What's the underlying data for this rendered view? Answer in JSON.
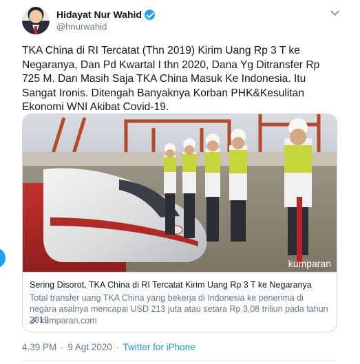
{
  "author": {
    "name": "Hidayat Nur Wahid",
    "handle": "@hnurwahid"
  },
  "tweet": {
    "text": "TKA China di RI Tercatat (Thn 2019) Kirim Uang Rp 3 T ke Negaranya, Dan Pd Kwartal I thn 2020, Dana Yg Ditransfer Rp 725 M. Dan Masih Saja TKA China Masuk Ke Indonesia. Itu Sangat Ironis. Ditengah Banyaknya Korban PHK&Kesulitan Ekonomi WNI Akibat Covid-19."
  },
  "card": {
    "watermark": "kumparan",
    "title": "Sering Disorot, TKA China di RI Tercatat Kirim Uang Rp 3 T ke Negaranya",
    "description": "Total transfer uang TKA China yang bekerja di Indonesia ke penerima di negara asalnya mencapai USD 213 juta atau setara Rp 3,08 triliun pada tahun 2019.",
    "domain": "kumparan.com"
  },
  "meta": {
    "time": "4.39 PM",
    "separator": "·",
    "date": "9 Agt 2020",
    "source": "Twitter for iPhone"
  },
  "colors": {
    "accent": "#1da1f2",
    "link": "#1b95e0",
    "secondary_text": "#657786",
    "border": "#ccd6dd"
  },
  "icons": {
    "verified": "verified-badge-icon",
    "menu": "chevron-down-icon",
    "link": "link-icon"
  }
}
